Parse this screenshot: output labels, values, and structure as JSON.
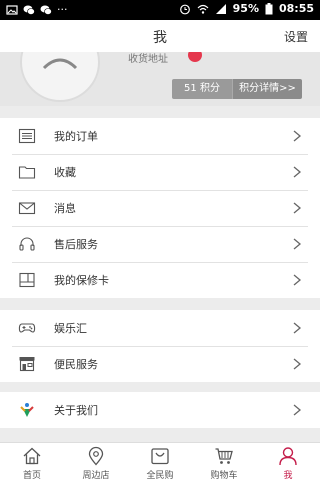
{
  "status_bar": {
    "battery": "95%",
    "time": "08:55"
  },
  "header": {
    "title": "我",
    "settings": "设置"
  },
  "profile": {
    "address_label": "收货地址",
    "points_label": "51 积分",
    "points_detail": "积分详情>>"
  },
  "menu_groups": [
    {
      "items": [
        {
          "label": "我的订单",
          "icon": "order-list-icon"
        },
        {
          "label": "收藏",
          "icon": "folder-icon"
        },
        {
          "label": "消息",
          "icon": "envelope-icon"
        },
        {
          "label": "售后服务",
          "icon": "headset-icon"
        },
        {
          "label": "我的保修卡",
          "icon": "warranty-card-icon"
        }
      ]
    },
    {
      "items": [
        {
          "label": "娱乐汇",
          "icon": "gamepad-icon"
        },
        {
          "label": "便民服务",
          "icon": "storefront-icon"
        }
      ]
    },
    {
      "items": [
        {
          "label": "关于我们",
          "icon": "about-icon"
        }
      ]
    }
  ],
  "tabs": [
    {
      "label": "首页",
      "icon": "home-icon"
    },
    {
      "label": "周边店",
      "icon": "location-pin-icon"
    },
    {
      "label": "全民购",
      "icon": "shopping-bag-icon"
    },
    {
      "label": "购物车",
      "icon": "cart-icon"
    },
    {
      "label": "我",
      "icon": "user-icon",
      "active": true
    }
  ],
  "colors": {
    "accent": "#c41d4a",
    "badge": "#e5374d"
  }
}
